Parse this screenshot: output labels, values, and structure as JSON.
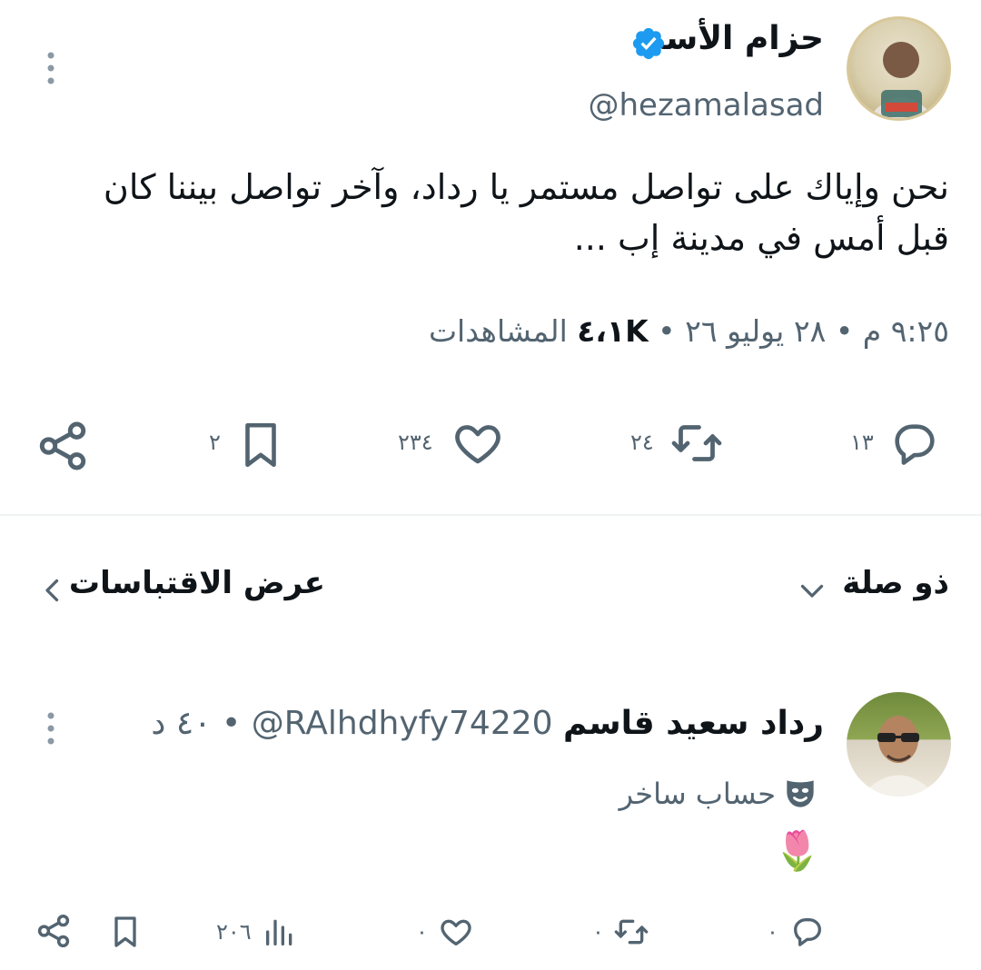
{
  "main_tweet": {
    "author_name": "حزام الأسد",
    "handle": "@hezamalasad",
    "verified": true,
    "text_line1": "نحن وإياك على تواصل مستمر يا رداد، وآخر تواصل بيننا كان",
    "text_line2": "قبل أمس في مدينة إب ...",
    "time": "٩:٢٥ م",
    "date": "٢٨ يوليو ٢٦",
    "views_count": "٤،١K",
    "views_label": "المشاهدات",
    "separator": "•",
    "replies_count": "١٣",
    "retweets_count": "٢٤",
    "likes_count": "٢٣٤",
    "bookmarks_count": "٢",
    "accent_color": "#1d9bf0"
  },
  "related": {
    "left_label": "عرض الاقتباسات",
    "right_label": "ذو صلة"
  },
  "reply": {
    "author_name": "رداد سعيد قاسم",
    "handle": "@RAlhdhyfy74220",
    "time_ago": "٤٠ د",
    "separator": "•",
    "label": "حساب ساخر",
    "content": "🌷",
    "replies_count": "٠",
    "retweets_count": "٠",
    "likes_count": "٠",
    "views_count": "٢٠٦"
  },
  "icons": [
    "verified-badge-icon",
    "more-vertical-icon",
    "reply-icon",
    "retweet-icon",
    "like-icon",
    "bookmark-icon",
    "share-icon",
    "views-icon",
    "chevron-down-icon",
    "chevron-left-icon",
    "parody-mask-icon"
  ]
}
